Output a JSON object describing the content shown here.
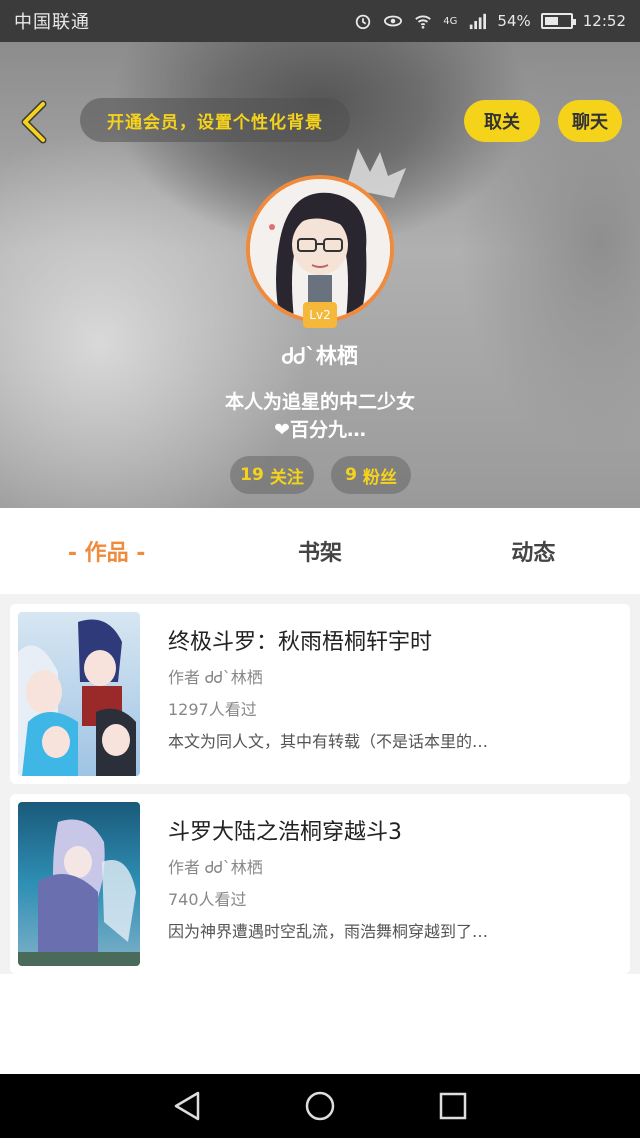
{
  "status_bar": {
    "carrier": "中国联通",
    "network": "4G",
    "battery": "54%",
    "battery_level": 0.54,
    "time": "12:52"
  },
  "header": {
    "vip_prompt": "开通会员，设置个性化背景",
    "follow_button": "取关",
    "chat_button": "聊天",
    "level_badge": "Lv2",
    "username": "ᏧᏧ`林栖",
    "bio_line1": "本人为追星的中二少女",
    "bio_line2": "❤百分九…",
    "following_count": "19",
    "following_label": "关注",
    "fans_count": "9",
    "fans_label": "粉丝"
  },
  "tabs": [
    {
      "label": "- 作品 -",
      "active": true
    },
    {
      "label": "书架",
      "active": false
    },
    {
      "label": "动态",
      "active": false
    }
  ],
  "works": [
    {
      "title": "终极斗罗：秋雨梧桐轩宇时",
      "author": "作者 ᏧᏧ`林栖",
      "views": "1297人看过",
      "desc": "本文为同人文，其中有转载（不是话本里的…"
    },
    {
      "title": "斗罗大陆之浩桐穿越斗3",
      "author": "作者 ᏧᏧ`林栖",
      "views": "740人看过",
      "desc": "因为神界遭遇时空乱流，雨浩舞桐穿越到了…"
    }
  ],
  "colors": {
    "accent_orange": "#f08a3c",
    "accent_yellow": "#f6d31b"
  }
}
